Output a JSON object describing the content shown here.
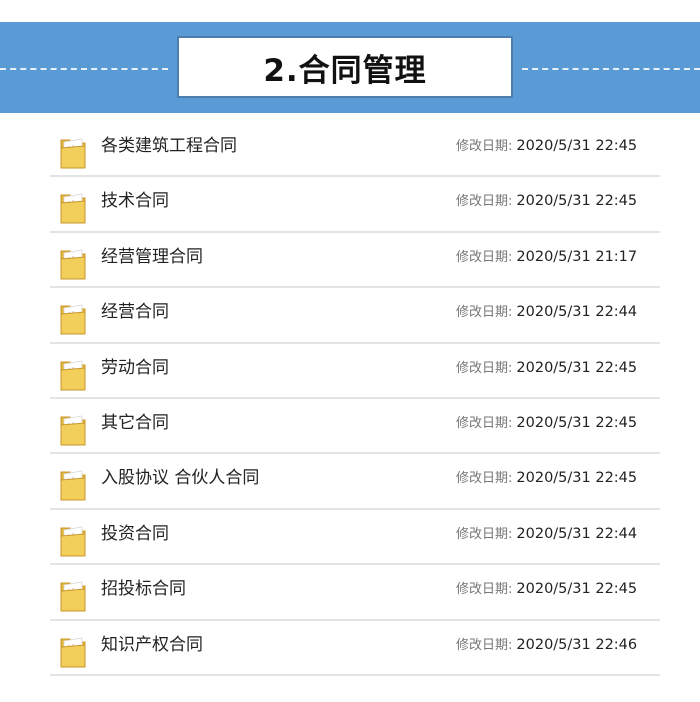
{
  "header": {
    "title": "2.合同管理"
  },
  "colors": {
    "banner": "#5b9bd5",
    "folder": "#f2cf5b"
  },
  "file_list": {
    "meta_label": "修改日期:",
    "items": [
      {
        "name": "各类建筑工程合同",
        "modified": "2020/5/31 22:45",
        "icon": "folder-icon"
      },
      {
        "name": "技术合同",
        "modified": "2020/5/31 22:45",
        "icon": "folder-icon"
      },
      {
        "name": "经营管理合同",
        "modified": "2020/5/31 21:17",
        "icon": "folder-icon"
      },
      {
        "name": "经营合同",
        "modified": "2020/5/31 22:44",
        "icon": "folder-icon"
      },
      {
        "name": "劳动合同",
        "modified": "2020/5/31 22:45",
        "icon": "folder-icon"
      },
      {
        "name": "其它合同",
        "modified": "2020/5/31 22:45",
        "icon": "folder-icon"
      },
      {
        "name": "入股协议 合伙人合同",
        "modified": "2020/5/31 22:45",
        "icon": "folder-icon"
      },
      {
        "name": "投资合同",
        "modified": "2020/5/31 22:44",
        "icon": "folder-icon"
      },
      {
        "name": "招投标合同",
        "modified": "2020/5/31 22:45",
        "icon": "folder-icon"
      },
      {
        "name": "知识产权合同",
        "modified": "2020/5/31 22:46",
        "icon": "folder-icon"
      }
    ]
  }
}
